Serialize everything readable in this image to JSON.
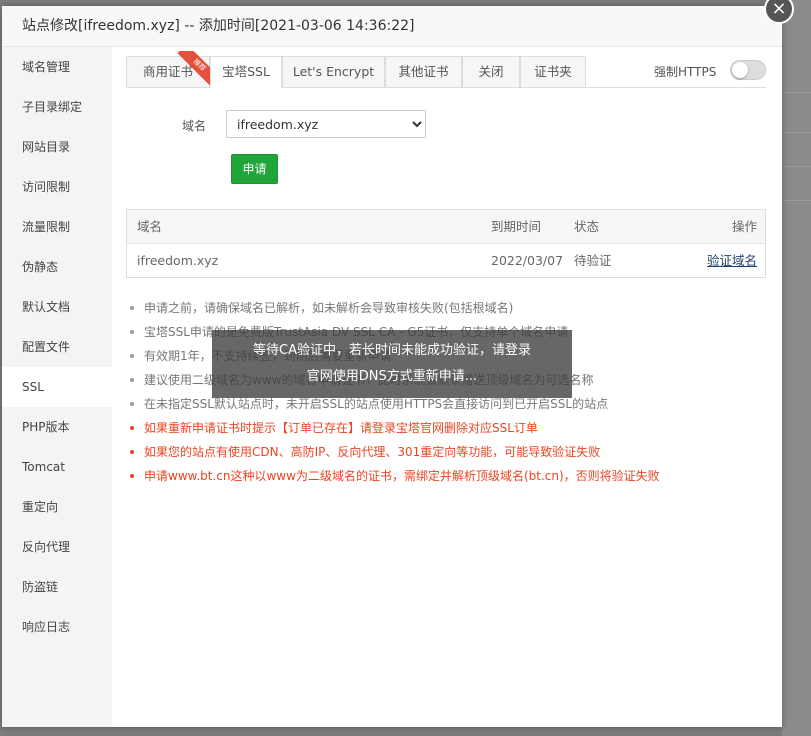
{
  "modal": {
    "title": "站点修改[ifreedom.xyz] -- 添加时间[2021-03-06 14:36:22]",
    "close": "×"
  },
  "sidebar": {
    "items": [
      {
        "label": "域名管理"
      },
      {
        "label": "子目录绑定"
      },
      {
        "label": "网站目录"
      },
      {
        "label": "访问限制"
      },
      {
        "label": "流量限制"
      },
      {
        "label": "伪静态"
      },
      {
        "label": "默认文档"
      },
      {
        "label": "配置文件"
      },
      {
        "label": "SSL",
        "active": true
      },
      {
        "label": "PHP版本"
      },
      {
        "label": "Tomcat"
      },
      {
        "label": "重定向"
      },
      {
        "label": "反向代理"
      },
      {
        "label": "防盗链"
      },
      {
        "label": "响应日志"
      }
    ]
  },
  "tabs": {
    "items": [
      {
        "label": "商用证书"
      },
      {
        "label": "宝塔SSL",
        "active": true
      },
      {
        "label": "Let's Encrypt"
      },
      {
        "label": "其他证书"
      },
      {
        "label": "关闭"
      },
      {
        "label": "证书夹"
      }
    ],
    "ribbon": "推荐",
    "force_https_label": "强制HTTPS"
  },
  "form": {
    "domain_label": "域名",
    "domain_value": "ifreedom.xyz",
    "apply_label": "申请"
  },
  "table": {
    "headers": [
      "域名",
      "到期时间",
      "状态",
      "操作"
    ],
    "rows": [
      {
        "domain": "ifreedom.xyz",
        "expire": "2022/03/07",
        "status": "待验证",
        "action": "验证域名"
      }
    ]
  },
  "notes": [
    {
      "text": "申请之前，请确保域名已解析，如未解析会导致审核失败(包括根域名)",
      "red": false
    },
    {
      "text": "宝塔SSL申请的是免费版TrustAsia DV SSL CA - G5证书，仅支持单个域名申请",
      "red": false
    },
    {
      "text": "有效期1年，不支持续签，到期后需要重新申请",
      "red": false
    },
    {
      "text": "建议使用二级域名为www的域名申请证书，此时系统会默认赠送顶级域名为可选名称",
      "red": false
    },
    {
      "text": "在未指定SSL默认站点时，未开启SSL的站点使用HTTPS会直接访问到已开启SSL的站点",
      "red": false
    },
    {
      "text": "如果重新申请证书时提示【订单已存在】请登录宝塔官网删除对应SSL订单",
      "red": true
    },
    {
      "text": "如果您的站点有使用CDN、高防IP、反向代理、301重定向等功能，可能导致验证失败",
      "red": true
    },
    {
      "text": "申请www.bt.cn这种以www为二级域名的证书，需绑定并解析顶级域名(bt.cn)，否则将验证失败",
      "red": true
    }
  ],
  "toast": {
    "line1": "等待CA验证中，若长时间未能成功验证，请登录",
    "line2": "官网使用DNS方式重新申请..."
  }
}
